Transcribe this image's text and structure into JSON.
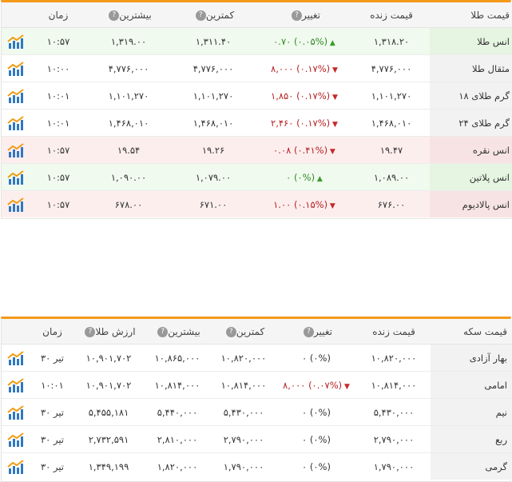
{
  "gold": {
    "headers": {
      "name": "قیمت طلا",
      "live": "قیمت زنده",
      "change": "تغییر",
      "low": "کمترین",
      "high": "بیشترین",
      "time": "زمان"
    },
    "rows": [
      {
        "name": "انس طلا",
        "live": "۱,۳۱۸.۲۰",
        "change": "۰.۷۰ (۰.۰۵%)",
        "dir": "up",
        "low": "۱,۳۱۱.۴۰",
        "high": "۱,۳۱۹.۰۰",
        "time": "۱۰:۵۷"
      },
      {
        "name": "مثقال طلا",
        "live": "۴,۷۷۶,۰۰۰",
        "change": "۸,۰۰۰ (۰.۱۷%)",
        "dir": "down",
        "low": "۴,۷۷۶,۰۰۰",
        "high": "۴,۷۷۶,۰۰۰",
        "time": "۱۰:۰۰"
      },
      {
        "name": "گرم طلای ۱۸",
        "live": "۱,۱۰۱,۲۷۰",
        "change": "۱,۸۵۰ (۰.۱۷%)",
        "dir": "down",
        "low": "۱,۱۰۱,۲۷۰",
        "high": "۱,۱۰۱,۲۷۰",
        "time": "۱۰:۰۱"
      },
      {
        "name": "گرم طلای ۲۴",
        "live": "۱,۴۶۸,۰۱۰",
        "change": "۲,۴۶۰ (۰.۱۷%)",
        "dir": "down",
        "low": "۱,۴۶۸,۰۱۰",
        "high": "۱,۴۶۸,۰۱۰",
        "time": "۱۰:۰۱"
      },
      {
        "name": "انس نقره",
        "live": "۱۹.۴۷",
        "change": "۰.۰۸ (۰.۴۱%)",
        "dir": "down",
        "low": "۱۹.۲۶",
        "high": "۱۹.۵۴",
        "time": "۱۰:۵۷"
      },
      {
        "name": "انس پلاتین",
        "live": "۱,۰۸۹.۰۰",
        "change": "۰ (۰%)",
        "dir": "up",
        "low": "۱,۰۷۹.۰۰",
        "high": "۱,۰۹۰.۰۰",
        "time": "۱۰:۵۷"
      },
      {
        "name": "انس پالادیوم",
        "live": "۶۷۶.۰۰",
        "change": "۱.۰۰ (۰.۱۵%)",
        "dir": "down",
        "low": "۶۷۱.۰۰",
        "high": "۶۷۸.۰۰",
        "time": "۱۰:۵۷"
      }
    ]
  },
  "coin": {
    "headers": {
      "name": "قیمت سکه",
      "live": "قیمت زنده",
      "change": "تغییر",
      "low": "کمترین",
      "high": "بیشترین",
      "value": "ارزش طلا",
      "time": "زمان"
    },
    "rows": [
      {
        "name": "بهار آزادی",
        "live": "۱۰,۸۲۰,۰۰۰",
        "change": "۰ (۰%)",
        "dir": "none",
        "low": "۱۰,۸۲۰,۰۰۰",
        "high": "۱۰,۸۶۵,۰۰۰",
        "value": "۱۰,۹۰۱,۷۰۲",
        "time": "۳۰ تیر"
      },
      {
        "name": "امامی",
        "live": "۱۰,۸۱۴,۰۰۰",
        "change": "۸,۰۰۰ (۰.۰۷%)",
        "dir": "down",
        "low": "۱۰,۸۱۴,۰۰۰",
        "high": "۱۰,۸۱۴,۰۰۰",
        "value": "۱۰,۹۰۱,۷۰۲",
        "time": "۱۰:۰۱"
      },
      {
        "name": "نیم",
        "live": "۵,۴۳۰,۰۰۰",
        "change": "۰ (۰%)",
        "dir": "none",
        "low": "۵,۴۳۰,۰۰۰",
        "high": "۵,۴۴۰,۰۰۰",
        "value": "۵,۴۵۵,۱۸۱",
        "time": "۳۰ تیر"
      },
      {
        "name": "ربع",
        "live": "۲,۷۹۰,۰۰۰",
        "change": "۰ (۰%)",
        "dir": "none",
        "low": "۲,۷۹۰,۰۰۰",
        "high": "۲,۸۱۰,۰۰۰",
        "value": "۲,۷۳۲,۵۹۱",
        "time": "۳۰ تیر"
      },
      {
        "name": "گرمی",
        "live": "۱,۷۹۰,۰۰۰",
        "change": "۰ (۰%)",
        "dir": "none",
        "low": "۱,۷۹۰,۰۰۰",
        "high": "۱,۸۲۰,۰۰۰",
        "value": "۱,۳۴۹,۱۹۹",
        "time": "۳۰ تیر"
      }
    ]
  },
  "icons": {
    "chart": "chart-icon",
    "help": "?"
  },
  "colors": {
    "accent": "#f59a1a",
    "up": "#2e8a22",
    "down": "#b72020"
  }
}
